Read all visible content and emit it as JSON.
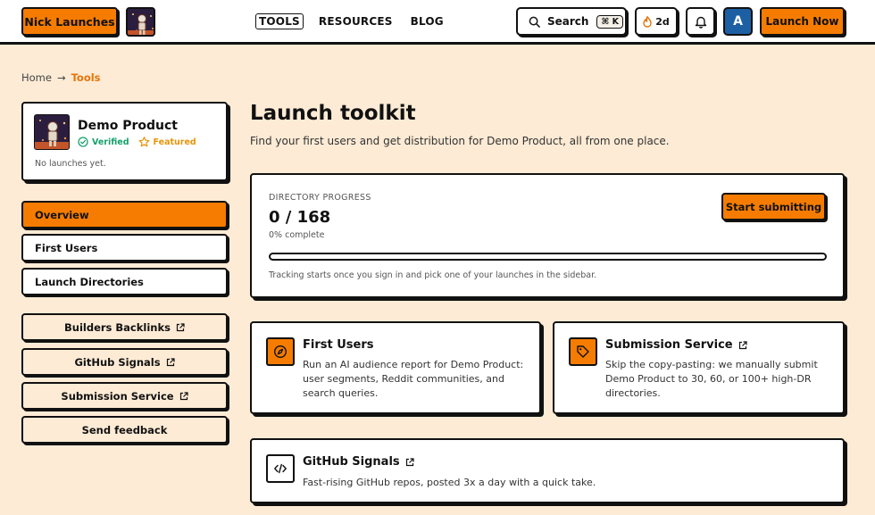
{
  "header": {
    "brand_label": "Nick Launches",
    "nav": [
      {
        "label": "TOOLS",
        "active": true
      },
      {
        "label": "RESOURCES",
        "active": false
      },
      {
        "label": "BLOG",
        "active": false
      }
    ],
    "search": {
      "label": "Search",
      "shortcut": "⌘ K",
      "icon": "search-icon"
    },
    "streak": {
      "label": "2d",
      "icon": "flame-icon"
    },
    "notifications_icon": "bell-icon",
    "user_initial": "A",
    "launch_label": "Launch Now"
  },
  "breadcrumb": {
    "home": "Home",
    "separator": "→",
    "current": "Tools"
  },
  "sidebar": {
    "product": {
      "name": "Demo Product",
      "verified": "Verified",
      "featured": "Featured",
      "status": "No launches yet."
    },
    "nav": [
      {
        "label": "Overview",
        "active": true
      },
      {
        "label": "First Users",
        "active": false
      },
      {
        "label": "Launch Directories",
        "active": false
      }
    ],
    "links": [
      {
        "label": "Builders Backlinks",
        "external": true
      },
      {
        "label": "GitHub Signals",
        "external": true
      },
      {
        "label": "Submission Service",
        "external": true
      },
      {
        "label": "Send feedback",
        "external": false
      }
    ]
  },
  "main": {
    "title": "Launch toolkit",
    "subtitle": "Find your first users and get distribution for Demo Product, all from one place.",
    "progress": {
      "label": "DIRECTORY PROGRESS",
      "value": "0 / 168",
      "percent_text": "0% complete",
      "percent": 0,
      "cta": "Start submitting",
      "note": "Tracking starts once you sign in and pick one of your launches in the sidebar."
    },
    "tools": [
      {
        "title": "First Users",
        "icon": "compass-icon",
        "external": false,
        "lines": [
          "Run an AI audience report for Demo Product:",
          "user segments, Reddit communities, and",
          "search queries."
        ]
      },
      {
        "title": "Submission Service",
        "icon": "tag-icon",
        "external": true,
        "lines": [
          "Skip the copy-pasting: we manually submit",
          "Demo Product to 30, 60, or 100+ high-DR",
          "directories."
        ]
      },
      {
        "title": "GitHub Signals",
        "icon": "code-icon",
        "external": true,
        "lines": [
          "Fast-rising GitHub repos, posted 3x a day with a quick take."
        ]
      }
    ]
  },
  "colors": {
    "accent": "#f57c00",
    "background": "#fdebd5",
    "verified": "#16a06c",
    "featured": "#e8940a",
    "user_avatar": "#1d5fa3"
  }
}
